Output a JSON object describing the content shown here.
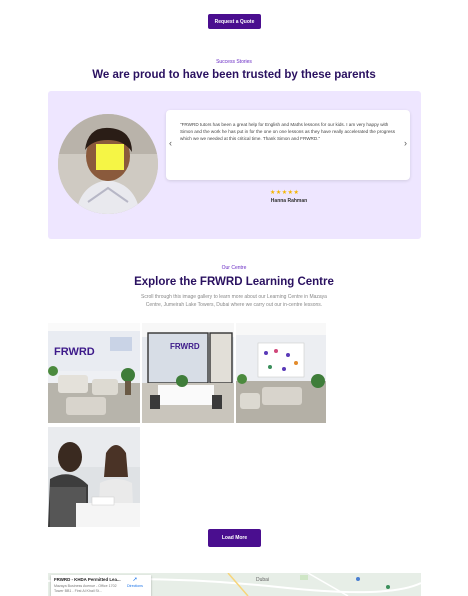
{
  "buttons": {
    "request_quote": "Request a Quote",
    "load_more": "Load More"
  },
  "stories": {
    "eyebrow": "Success Stories",
    "title": "We are proud to have been trusted by these parents"
  },
  "testimonial": {
    "quote": "\"FRWRD tutors has been a great help for English and Maths lessons for our kids. I am very happy with Simon and the work he has put in for the one on one lessons as they have really accelerated the progress which we we needed at this critical time. Thank Simon and FRWRD.\"",
    "stars": "★★★★★",
    "rating": 5,
    "author": "Hanna Rahman",
    "prev_icon": "chevron-left-icon",
    "next_icon": "chevron-right-icon"
  },
  "centre": {
    "eyebrow": "Our Centre",
    "title": "Explore the FRWRD Learning Centre",
    "description": "Scroll through this image gallery to learn more about our Learning Centre in Mazaya Centre, Jumeirah Lake Towers, Dubai where we carry out our in-centre lessons."
  },
  "gallery": {
    "photos": [
      {
        "name": "reception-lounge-photo",
        "logo_text": "FRWRD"
      },
      {
        "name": "glass-classroom-photo",
        "logo_text": "FRWRD"
      },
      {
        "name": "open-study-area-photo"
      },
      {
        "name": "tutoring-session-photo"
      }
    ]
  },
  "map": {
    "title": "FRWRD - KHDA Permitted Lea...",
    "address": "Mazaya Business Avenue - Office 1702 Tower BB1 - First Al Khail St...",
    "directions": "Directions",
    "city": "Dubai"
  },
  "colors": {
    "brand_purple": "#4a0e8f",
    "title_navy": "#2a1160",
    "panel_lavender": "#eee6ff",
    "star_gold": "#f4b400"
  }
}
